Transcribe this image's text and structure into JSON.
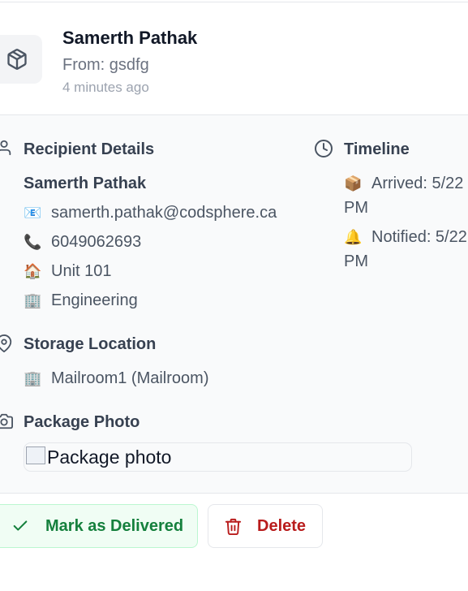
{
  "header": {
    "title": "Samerth Pathak",
    "from": "From: gsdfg",
    "time_ago": "4 minutes ago",
    "icon": "package-icon"
  },
  "recipient": {
    "heading": "Recipient Details",
    "name": "Samerth Pathak",
    "email": "samerth.pathak@codsphere.ca",
    "phone": "6049062693",
    "unit": "Unit 101",
    "department": "Engineering",
    "icons": {
      "email": "📧",
      "phone": "📞",
      "unit": "🏠",
      "department": "🏢"
    }
  },
  "timeline": {
    "heading": "Timeline",
    "arrived": "Arrived: 5/22",
    "arrived_cont": "PM",
    "notified": "Notified: 5/22",
    "notified_cont": "PM",
    "icons": {
      "arrived": "📦",
      "notified": "🔔"
    }
  },
  "storage": {
    "heading": "Storage Location",
    "location": "Mailroom1 (Mailroom)",
    "icon": "🏢"
  },
  "photo": {
    "heading": "Package Photo",
    "alt": "Package photo"
  },
  "actions": {
    "deliver_label": "Mark as Delivered",
    "delete_label": "Delete"
  },
  "colors": {
    "deliver_text": "#15803d",
    "deliver_bg": "#f0fdf4",
    "delete_text": "#b91c1c"
  }
}
